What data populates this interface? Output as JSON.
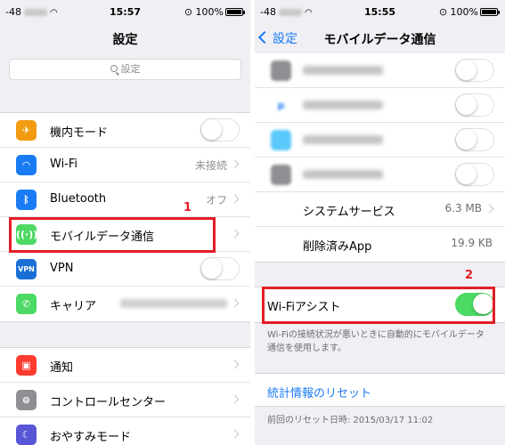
{
  "left": {
    "status": {
      "signal": "-48",
      "time": "15:57",
      "battery": "100%"
    },
    "nav_title": "設定",
    "search_placeholder": "設定",
    "group1": [
      {
        "label": "機内モード",
        "icon": "airplane-icon",
        "color": "#f39c12",
        "control": "toggle",
        "on": false
      },
      {
        "label": "Wi-Fi",
        "icon": "wifi-icon",
        "color": "#1a7cf5",
        "value": "未接続"
      },
      {
        "label": "Bluetooth",
        "icon": "bluetooth-icon",
        "color": "#1a7cf5",
        "value": "オフ"
      },
      {
        "label": "モバイルデータ通信",
        "icon": "antenna-icon",
        "color": "#4cd964"
      },
      {
        "label": "VPN",
        "icon": "vpn-icon",
        "color": "#1a6fd6",
        "control": "toggle",
        "on": false
      },
      {
        "label": "キャリア",
        "icon": "phone-icon",
        "color": "#4cd964"
      }
    ],
    "group2": [
      {
        "label": "通知",
        "icon": "notification-icon",
        "color": "#ff3b30"
      },
      {
        "label": "コントロールセンター",
        "icon": "control-center-icon",
        "color": "#8e8e93"
      },
      {
        "label": "おやすみモード",
        "icon": "moon-icon",
        "color": "#5856d6"
      }
    ],
    "callout": "1"
  },
  "right": {
    "status": {
      "signal": "-48",
      "time": "15:55",
      "battery": "100%"
    },
    "back_label": "設定",
    "nav_title": "モバイルデータ通信",
    "system_services_label": "システムサービス",
    "system_services_value": "6.3 MB",
    "deleted_apps_label": "削除済みApp",
    "deleted_apps_value": "19.9 KB",
    "wifi_assist_label": "Wi-Fiアシスト",
    "wifi_assist_on": true,
    "wifi_assist_desc": "Wi-Fiの接続状況が悪いときに自動的にモバイルデータ通信を使用します。",
    "reset_label": "統計情報のリセット",
    "last_reset": "前回のリセット日時: 2015/03/17 11:02",
    "callout": "2"
  },
  "colors": {
    "accent": "#1a7cf5",
    "toggle_on": "#4cd964",
    "highlight": "#e31e24"
  }
}
